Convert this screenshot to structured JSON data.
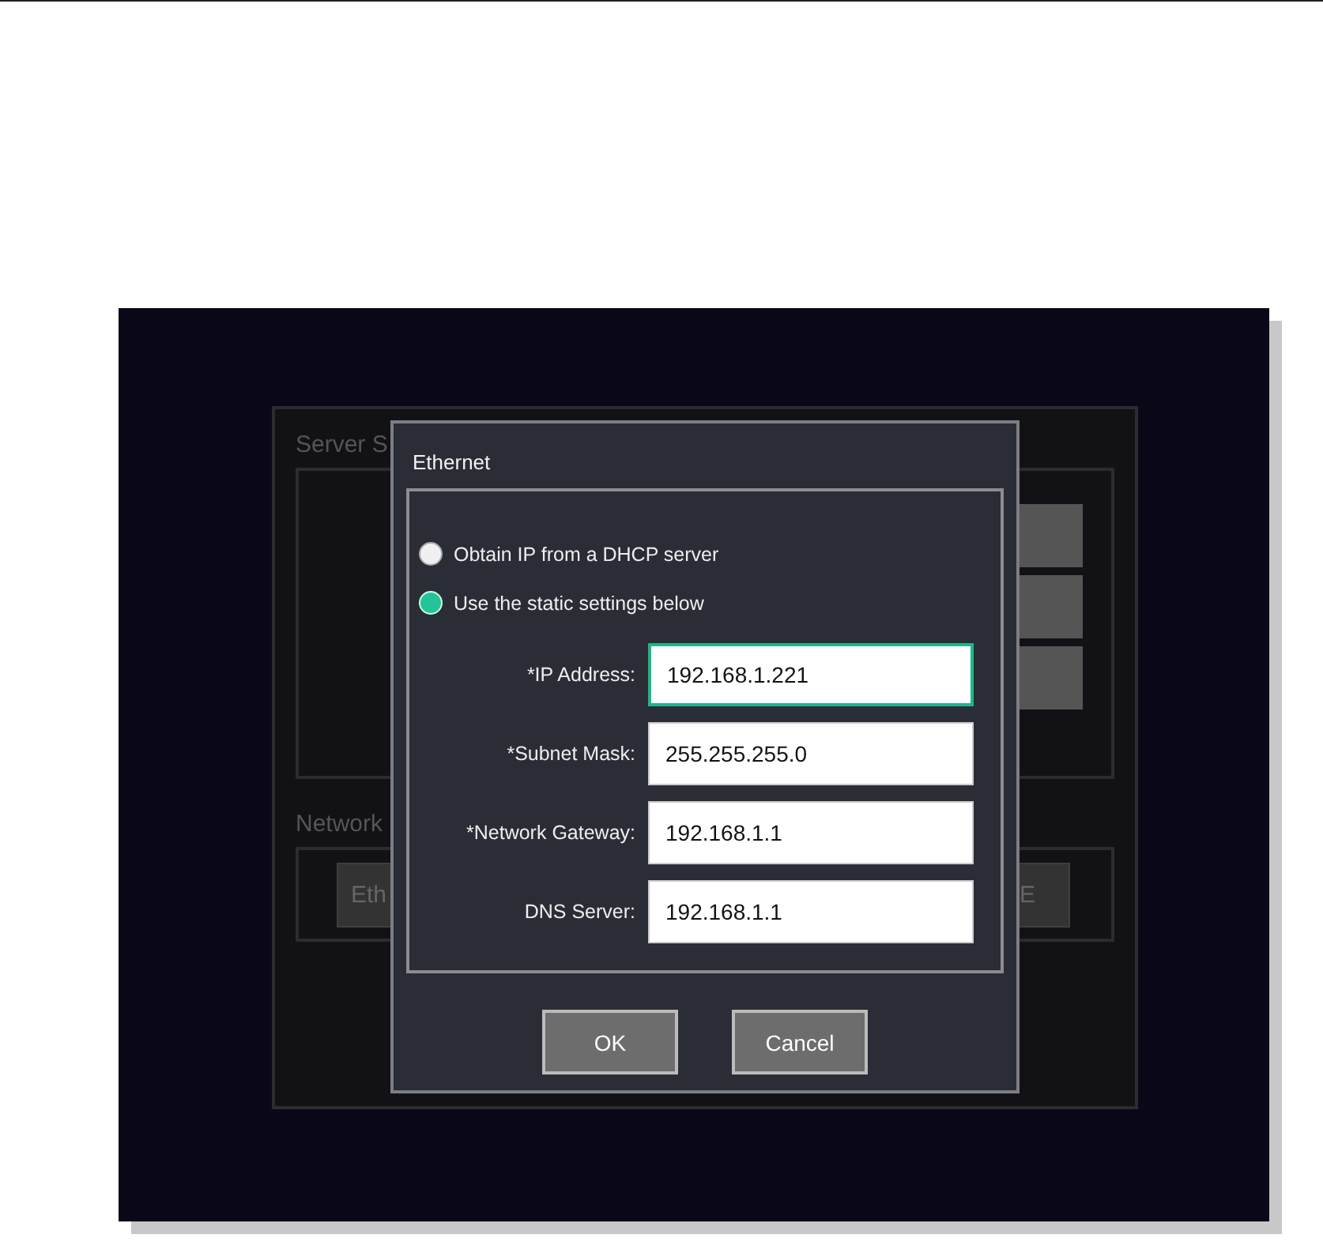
{
  "background": {
    "server_section": {
      "title": "Server S"
    },
    "network_section": {
      "title": "Network",
      "buttons": [
        "Eth",
        "E"
      ]
    }
  },
  "dialog": {
    "title": "Ethernet",
    "options": [
      {
        "label": "Obtain IP from a DHCP server",
        "selected": false
      },
      {
        "label": "Use the static settings below",
        "selected": true
      }
    ],
    "fields": [
      {
        "label": "*IP Address:",
        "value": "192.168.1.221",
        "focused": true
      },
      {
        "label": "*Subnet Mask:",
        "value": "255.255.255.0",
        "focused": false
      },
      {
        "label": "*Network Gateway:",
        "value": "192.168.1.1",
        "focused": false
      },
      {
        "label": "DNS Server:",
        "value": "192.168.1.1",
        "focused": false
      }
    ],
    "buttons": [
      "OK",
      "Cancel"
    ]
  }
}
